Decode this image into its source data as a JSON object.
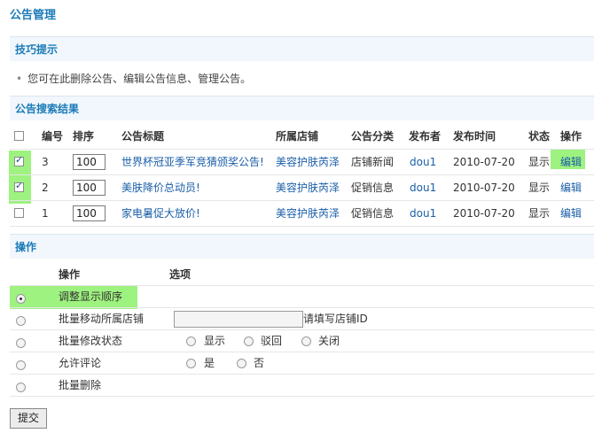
{
  "page_title": "公告管理",
  "tips": {
    "title": "技巧提示",
    "text": "您可在此删除公告、编辑公告信息、管理公告。"
  },
  "results": {
    "title": "公告搜索结果",
    "columns": [
      "编号",
      "排序",
      "公告标题",
      "所属店铺",
      "公告分类",
      "发布者",
      "发布时间",
      "状态",
      "操作"
    ],
    "rows": [
      {
        "checked": true,
        "id": "3",
        "sort": "100",
        "title": "世界杯冠亚季军竞猜颁奖公告!",
        "shop": "美容护肤芮泽",
        "category": "店铺新闻",
        "publisher": "dou1",
        "date": "2010-07-20",
        "status": "显示",
        "action": "编辑"
      },
      {
        "checked": true,
        "id": "2",
        "sort": "100",
        "title": "美肤降价总动员!",
        "shop": "美容护肤芮泽",
        "category": "促销信息",
        "publisher": "dou1",
        "date": "2010-07-20",
        "status": "显示",
        "action": "编辑"
      },
      {
        "checked": false,
        "id": "1",
        "sort": "100",
        "title": "家电暑促大放价!",
        "shop": "美容护肤芮泽",
        "category": "促销信息",
        "publisher": "dou1",
        "date": "2010-07-20",
        "status": "显示",
        "action": "编辑"
      }
    ]
  },
  "operations": {
    "title": "操作",
    "col_operation": "操作",
    "col_options": "选项",
    "items": [
      {
        "label": "调整显示顺序",
        "selected": true
      },
      {
        "label": "批量移动所属店铺",
        "selected": false,
        "input_hint": "请填写店铺ID"
      },
      {
        "label": "批量修改状态",
        "selected": false,
        "options": [
          "显示",
          "驳回",
          "关闭"
        ]
      },
      {
        "label": "允许评论",
        "selected": false,
        "options": [
          "是",
          "否"
        ]
      },
      {
        "label": "批量删除",
        "selected": false
      }
    ],
    "submit_label": "提交"
  },
  "colors": {
    "accent": "#1b7bb8",
    "highlight": "#9ef27f",
    "link": "#1a5ea8"
  }
}
